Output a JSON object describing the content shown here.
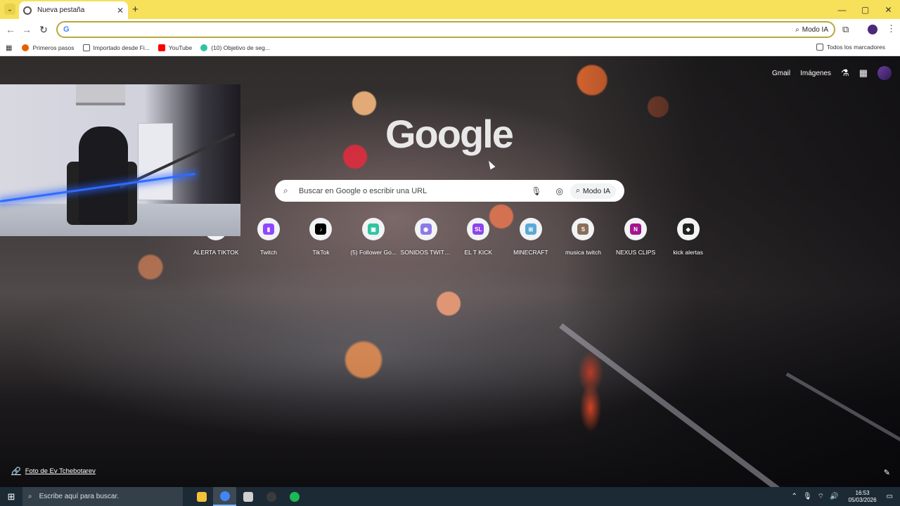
{
  "browser": {
    "tab": {
      "title": "Nueva pestaña",
      "close_glyph": "✕"
    },
    "new_tab_glyph": "+",
    "window_controls": [
      "—",
      "▢",
      "✕"
    ],
    "omnibox": {
      "value": "",
      "placeholder": "",
      "ai_label": "Modo IA"
    },
    "bookmarks": [
      {
        "label": "Primeros pasos",
        "icon": "firefox-icon",
        "color": "#e66000"
      },
      {
        "label": "Importado desde Fi...",
        "icon": "folder-icon",
        "color": "#ffffff"
      },
      {
        "label": "YouTube",
        "icon": "youtube-icon",
        "color": "#ff0000"
      },
      {
        "label": "(10) Objetivo de seg...",
        "icon": "streamlabs-icon",
        "color": "#31c3a2"
      }
    ],
    "all_bookmarks_label": "Todos los marcadores"
  },
  "newtab": {
    "top_links": {
      "gmail": "Gmail",
      "images": "Imágenes"
    },
    "logo": "Google",
    "search": {
      "placeholder": "Buscar en Google o escribir una URL",
      "ai_label": "Modo IA"
    },
    "shortcuts": [
      {
        "label": "ALERTA TIKTOK",
        "icon": "tiktok-alert-icon",
        "color": "#ffffff",
        "glyph": ""
      },
      {
        "label": "Twitch",
        "icon": "twitch-icon",
        "color": "#9146ff",
        "glyph": "▮"
      },
      {
        "label": "TikTok",
        "icon": "tiktok-icon",
        "color": "#000000",
        "glyph": "♪"
      },
      {
        "label": "(5) Follower Go...",
        "icon": "streamlabs-icon",
        "color": "#31c3a2",
        "glyph": "▣"
      },
      {
        "label": "SONIDOS TWITC...",
        "icon": "discord-like-icon",
        "color": "#8c7ae6",
        "glyph": "◉"
      },
      {
        "label": "EL T KICK",
        "icon": "sl-icon",
        "color": "#8e44ec",
        "glyph": "SL"
      },
      {
        "label": "MINECRAFT",
        "icon": "minecraft-icon",
        "color": "#5aa9d6",
        "glyph": "⊞"
      },
      {
        "label": "musica twitch",
        "icon": "s-icon",
        "color": "#8a6e5a",
        "glyph": "S"
      },
      {
        "label": "NEXUS CLIPS",
        "icon": "n-icon",
        "color": "#a4148f",
        "glyph": "N"
      },
      {
        "label": "kick alertas",
        "icon": "kick-icon",
        "color": "#222222",
        "glyph": "◆"
      }
    ],
    "photo_credit": "Foto de Ev Tchebotarev"
  },
  "taskbar": {
    "search_placeholder": "Escribe aquí para buscar.",
    "apps": [
      {
        "name": "file-explorer-icon",
        "color": "#f3c13a"
      },
      {
        "name": "chrome-icon",
        "color": "#4285f4"
      },
      {
        "name": "app-window-icon",
        "color": "#d0d0d0"
      },
      {
        "name": "obs-icon",
        "color": "#3b3b3b"
      },
      {
        "name": "spotify-icon",
        "color": "#1db954"
      }
    ],
    "time": "16:53",
    "date": "05/03/2026"
  }
}
